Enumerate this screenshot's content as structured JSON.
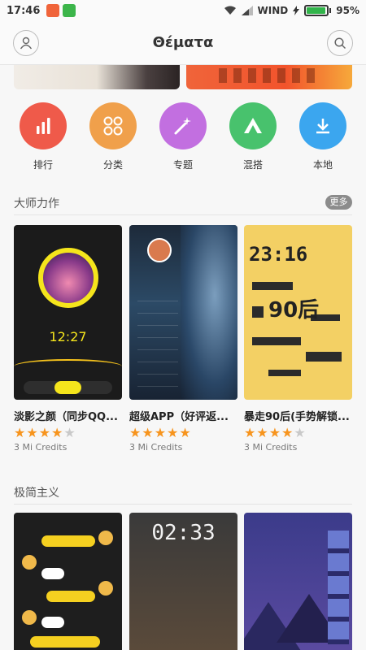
{
  "status": {
    "time": "17:46",
    "carrier": "WIND",
    "battery": "95%"
  },
  "header": {
    "title": "Θέματα"
  },
  "categories": [
    {
      "label": "排行",
      "color": "#ef5a4a",
      "icon": "bar-chart-icon"
    },
    {
      "label": "分类",
      "color": "#f0a04b",
      "icon": "grid-circles-icon"
    },
    {
      "label": "专题",
      "color": "#c26fe0",
      "icon": "magic-wand-icon"
    },
    {
      "label": "混搭",
      "color": "#48c26d",
      "icon": "triangle-icon"
    },
    {
      "label": "本地",
      "color": "#3ba6ef",
      "icon": "download-icon"
    }
  ],
  "section1": {
    "title": "大师力作",
    "more": "更多"
  },
  "themes": [
    {
      "name": "淡影之颜（同步QQ...",
      "price": "3 Mi Credits",
      "rating": 4.5
    },
    {
      "name": "超级APP（好评返...",
      "price": "3 Mi Credits",
      "rating": 5
    },
    {
      "name": "暴走90后(手势解锁...",
      "price": "3 Mi Credits",
      "rating": 4.5
    }
  ],
  "thumb1": {
    "clock": "12:27"
  },
  "thumb3": {
    "time": "23:16",
    "year": "90后"
  },
  "section2": {
    "title": "极简主义"
  },
  "thumb5": {
    "clock": "02:33"
  }
}
